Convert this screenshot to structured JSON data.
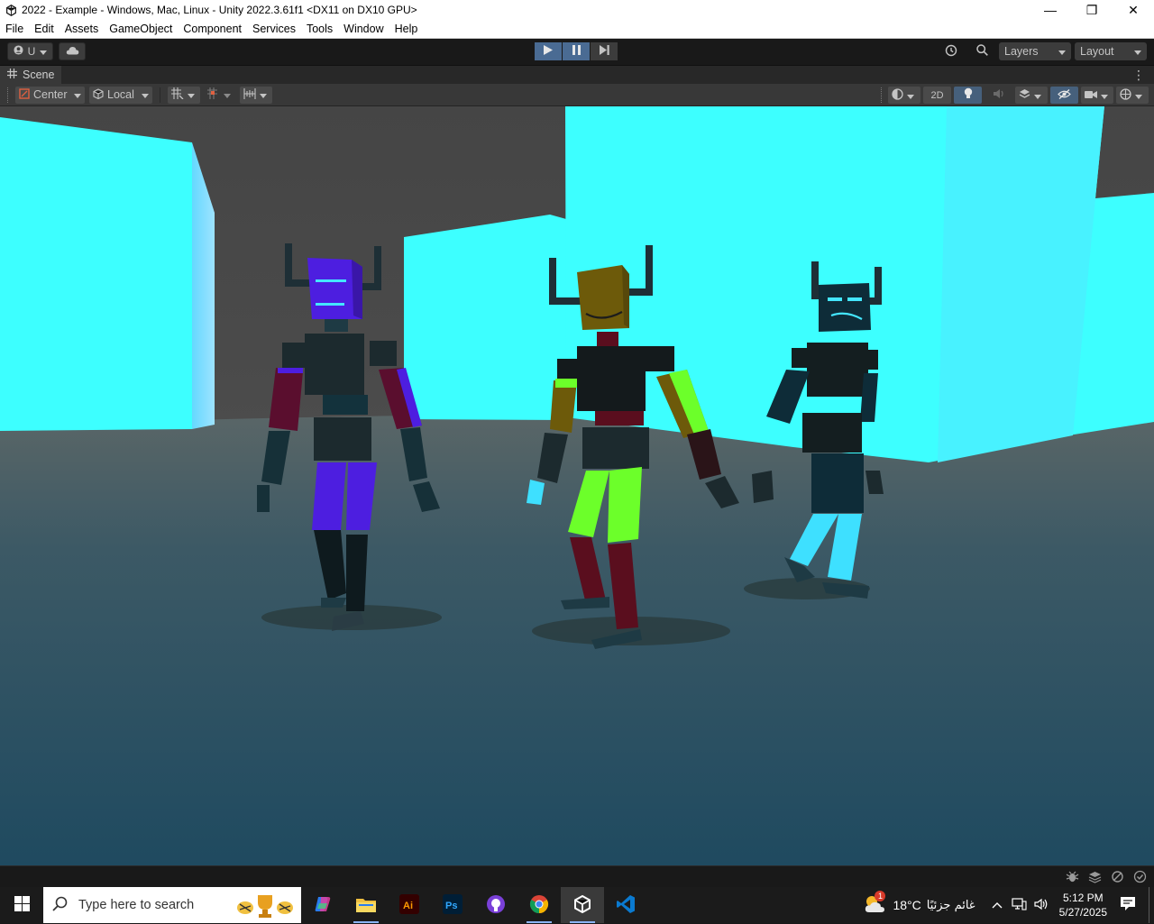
{
  "window": {
    "title": "2022 - Example - Windows, Mac, Linux - Unity 2022.3.61f1 <DX11 on DX10 GPU>",
    "minimize": "—",
    "maximize": "❐",
    "close": "✕"
  },
  "menu": [
    "File",
    "Edit",
    "Assets",
    "GameObject",
    "Component",
    "Services",
    "Tools",
    "Window",
    "Help"
  ],
  "toolbar": {
    "account_label": "U",
    "layers_label": "Layers",
    "layout_label": "Layout"
  },
  "scene_tab": {
    "label": "Scene"
  },
  "scene_tools": {
    "pivot_label": "Center",
    "space_label": "Local",
    "mode_2d_label": "2D"
  },
  "taskbar": {
    "search_placeholder": "Type here to search",
    "weather_temp": "18°C",
    "weather_desc": "غائم جزئيًا",
    "weather_badge": "1",
    "time": "5:12 PM",
    "date": "5/27/2025"
  },
  "colors": {
    "accent_play": "#4a6b93",
    "cyan_wall": "#3dffff",
    "sky_gray": "#4e4e4e"
  }
}
